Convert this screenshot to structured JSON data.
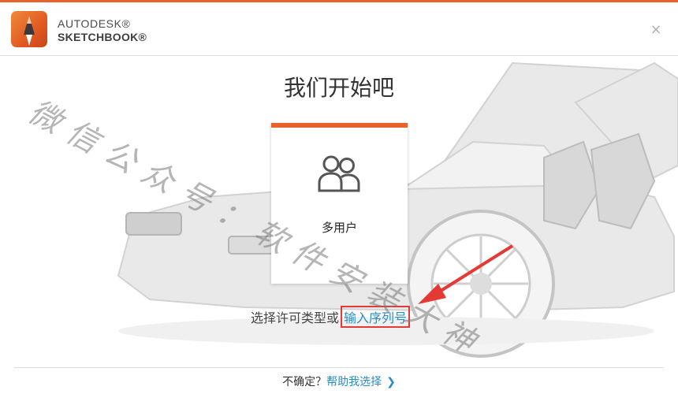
{
  "header": {
    "brand_top": "AUTODESK®",
    "brand_bottom": "SKETCHBOOK®",
    "close_glyph": "×",
    "logo_icon": "sketchbook-logo-icon"
  },
  "main": {
    "title": "我们开始吧",
    "card": {
      "label": "多用户",
      "icon": "users-icon",
      "accent_color": "#e8622c"
    },
    "license_prefix": "选择许可类型或",
    "serial_link": "输入序列号"
  },
  "footer": {
    "question": "不确定？",
    "help_link": "帮助我选择",
    "chevron": "❯"
  },
  "watermark": {
    "text": "微信公众号：软件安装大神"
  },
  "colors": {
    "accent": "#e8622c",
    "link": "#2a8cc4",
    "annotation": "#e53935"
  }
}
